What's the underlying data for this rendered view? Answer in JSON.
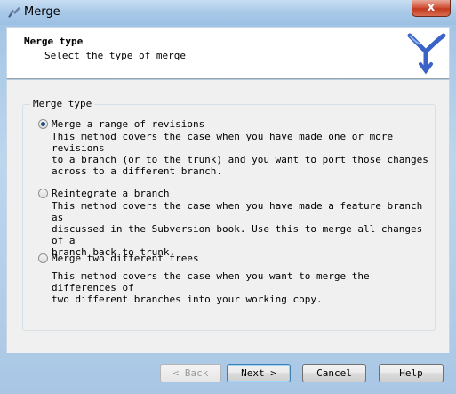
{
  "window": {
    "title": "Merge",
    "close_glyph": "x",
    "app_icon": "tortoise-merge-icon"
  },
  "header": {
    "title": "Merge type",
    "subtitle": "Select the type of merge",
    "logo_icon": "subversion-merge-logo-icon"
  },
  "group": {
    "legend": "Merge type",
    "options": [
      {
        "label": "Merge a range of revisions",
        "selected": true,
        "lines": [
          "This method covers the case when you have made one or more revisions",
          "to a branch (or to the trunk) and you want to port those changes",
          "across to a different branch."
        ]
      },
      {
        "label": "Reintegrate a branch",
        "selected": false,
        "lines": [
          "This method covers the case when you have made a feature branch as",
          "discussed in the Subversion book. Use this to merge all changes of a",
          "branch back to trunk."
        ]
      },
      {
        "label": "Merge two different trees",
        "selected": false,
        "lines": [
          "This method covers the case when you want to merge the differences of",
          "two different branches into your working copy."
        ]
      }
    ]
  },
  "buttons": {
    "back": "< Back",
    "next": "Next >",
    "cancel": "Cancel",
    "help": "Help"
  },
  "colors": {
    "accent": "#3b62c6",
    "selected_radio": "#1c5180"
  }
}
